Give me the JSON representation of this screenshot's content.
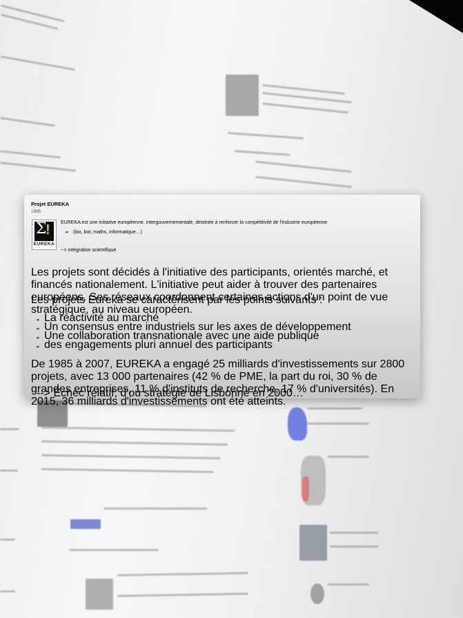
{
  "card": {
    "title": "Projet EUREKA",
    "year": "1985",
    "logo_text": "EUREKA",
    "intro": "EUREKA est une initiative européenne, intergouvernementale, destinée à renforcer la compétitivité de l'industrie européenne",
    "intro_sub": "(bio, bot, maths, informatique…)",
    "arrow_note": "--> intégration scientifique",
    "para1": "Les projets sont décidés à l'initiative des participants, orientés marché, et financés nationalement. L'initiative peut aider à trouver des partenaires européens. Ses réseaux coordonnent certaines actions d'un point de vue stratégique, au niveau européen.",
    "para2": "Les projets Eureka se caractérisent par les points suivants :",
    "bullets": [
      "La réactivité au marché",
      "Un consensus entre industriels sur les axes de développement",
      "Une collaboration transnationale avec une aide publique",
      "des engagements pluri annuel des participants"
    ],
    "para3": "De 1985 à 2007, EUREKA a engagé 25 milliards d'investissements sur 2800 projets, avec 13 000 partenaires (42 % de PME, la part du roi, 30 % de grandes entreprises, 11 % d'instituts de recherche, 17 % d'universités). En 2015, 36 milliards d'investissements ont été atteints.",
    "conclusion": "--> Échec relatif, d'où stratégie de Lisbonne en 2000…"
  }
}
